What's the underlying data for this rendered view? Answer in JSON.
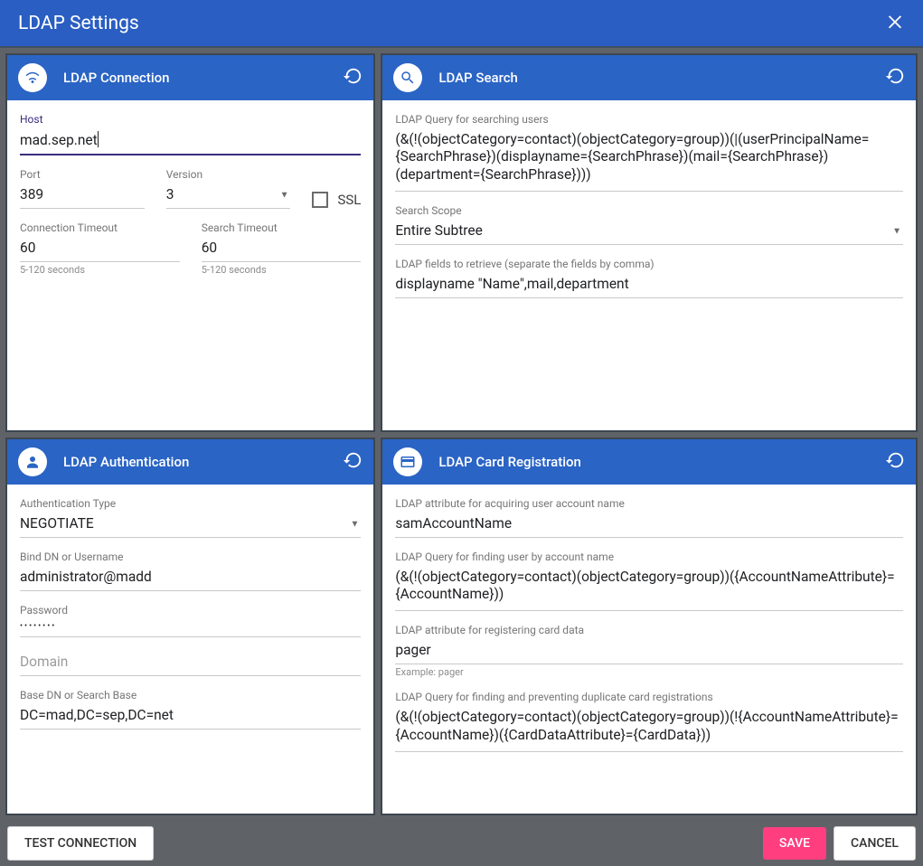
{
  "dialog_title": "LDAP Settings",
  "connection": {
    "title": "LDAP Connection",
    "host_label": "Host",
    "host_value": "mad.sep.net",
    "port_label": "Port",
    "port_value": "389",
    "version_label": "Version",
    "version_value": "3",
    "ssl_label": "SSL",
    "conn_timeout_label": "Connection Timeout",
    "conn_timeout_value": "60",
    "search_timeout_label": "Search Timeout",
    "search_timeout_value": "60",
    "timeout_hint": "5-120 seconds"
  },
  "search": {
    "title": "LDAP Search",
    "query_label": "LDAP Query for searching users",
    "query_value": "(&(!(objectCategory=contact)(objectCategory=group))(|(userPrincipalName={SearchPhrase})(displayname={SearchPhrase})(mail={SearchPhrase})(department={SearchPhrase})))",
    "scope_label": "Search Scope",
    "scope_value": "Entire Subtree",
    "fields_label": "LDAP fields to retrieve (separate the fields by comma)",
    "fields_value": "displayname \"Name\",mail,department"
  },
  "auth": {
    "title": "LDAP Authentication",
    "type_label": "Authentication Type",
    "type_value": "NEGOTIATE",
    "bind_label": "Bind DN or Username",
    "bind_value": "administrator@madd",
    "password_label": "Password",
    "password_value": "••••••••",
    "domain_placeholder": "Domain",
    "base_label": "Base DN or Search Base",
    "base_value": "DC=mad,DC=sep,DC=net"
  },
  "card": {
    "title": "LDAP Card Registration",
    "acct_attr_label": "LDAP attribute for acquiring user account name",
    "acct_attr_value": "samAccountName",
    "find_user_label": "LDAP Query for finding user by account name",
    "find_user_value": "(&(!(objectCategory=contact)(objectCategory=group))({AccountNameAttribute}={AccountName}))",
    "card_attr_label": "LDAP attribute for registering card data",
    "card_attr_value": "pager",
    "card_attr_hint": "Example: pager",
    "prevent_dup_label": "LDAP Query for finding and preventing duplicate card registrations",
    "prevent_dup_value": "(&(!(objectCategory=contact)(objectCategory=group))(!{AccountNameAttribute}={AccountName})({CardDataAttribute}={CardData}))"
  },
  "buttons": {
    "test": "TEST CONNECTION",
    "save": "SAVE",
    "cancel": "CANCEL"
  }
}
